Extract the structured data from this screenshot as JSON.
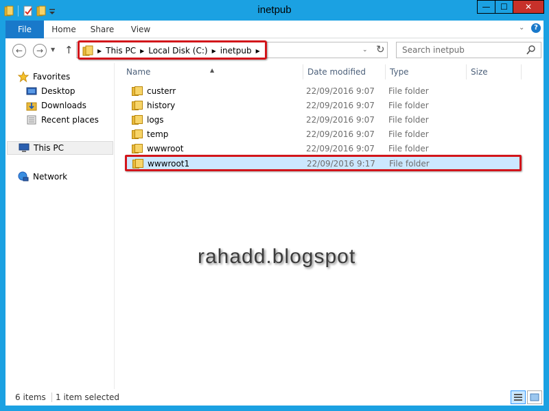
{
  "window": {
    "title": "inetpub",
    "min_glyph": "—",
    "max_glyph": "☐",
    "close_glyph": "✕"
  },
  "ribbon": {
    "tabs": [
      "File",
      "Home",
      "Share",
      "View"
    ]
  },
  "address": {
    "crumbs": [
      "This PC",
      "Local Disk (C:)",
      "inetpub"
    ],
    "search_placeholder": "Search inetpub"
  },
  "sidebar": {
    "favorites": "Favorites",
    "items": [
      "Desktop",
      "Downloads",
      "Recent places"
    ],
    "this_pc": "This PC",
    "network": "Network"
  },
  "columns": [
    "Name",
    "Date modified",
    "Type",
    "Size"
  ],
  "files": [
    {
      "name": "custerr",
      "date": "22/09/2016 9:07",
      "type": "File folder"
    },
    {
      "name": "history",
      "date": "22/09/2016 9:07",
      "type": "File folder"
    },
    {
      "name": "logs",
      "date": "22/09/2016 9:07",
      "type": "File folder"
    },
    {
      "name": "temp",
      "date": "22/09/2016 9:07",
      "type": "File folder"
    },
    {
      "name": "wwwroot",
      "date": "22/09/2016 9:07",
      "type": "File folder"
    },
    {
      "name": "wwwroot1",
      "date": "22/09/2016 9:17",
      "type": "File folder"
    }
  ],
  "watermark": "rahadd.blogspot",
  "status": {
    "count": "6 items",
    "selected": "1 item selected"
  },
  "colors": {
    "titlebar": "#1ba1e2",
    "file_tab": "#1979ca",
    "highlight": "#d2141a",
    "selected_row": "#cce8ff"
  }
}
